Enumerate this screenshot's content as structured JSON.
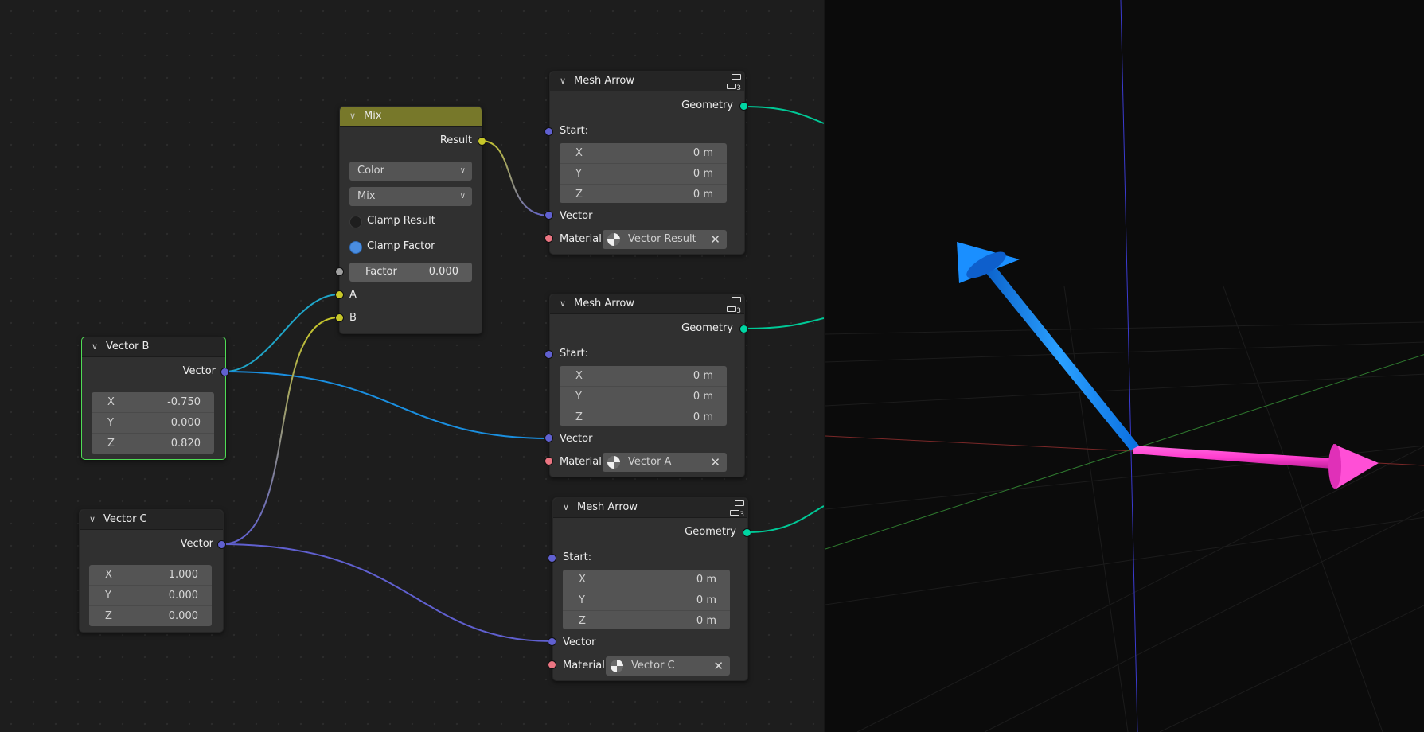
{
  "colors": {
    "vector_socket": "#6060d0",
    "geometry_socket": "#00d6a3",
    "material_socket": "#eb7582",
    "color_socket": "#c7c729",
    "arrow_blue": "#1a8fff",
    "arrow_pink": "#ff3fd0",
    "selected_outline": "#4fdc55"
  },
  "nodes": {
    "mix": {
      "title": "Mix",
      "output": "Result",
      "data_type": "Color",
      "blend_mode": "Mix",
      "clamp_result_label": "Clamp Result",
      "clamp_factor_label": "Clamp Factor",
      "factor_label": "Factor",
      "factor_value": "0.000",
      "input_a": "A",
      "input_b": "B"
    },
    "vector_b": {
      "title": "Vector B",
      "output": "Vector",
      "x_label": "X",
      "x": "-0.750",
      "y_label": "Y",
      "y": "0.000",
      "z_label": "Z",
      "z": "0.820"
    },
    "vector_c": {
      "title": "Vector C",
      "output": "Vector",
      "x_label": "X",
      "x": "1.000",
      "y_label": "Y",
      "y": "0.000",
      "z_label": "Z",
      "z": "0.000"
    },
    "arrow1": {
      "title": "Mesh Arrow",
      "badge": "3",
      "output": "Geometry",
      "start_label": "Start:",
      "x_label": "X",
      "x": "0 m",
      "y_label": "Y",
      "y": "0 m",
      "z_label": "Z",
      "z": "0 m",
      "vector_label": "Vector",
      "material_label": "Material:",
      "material": "Vector Result"
    },
    "arrow2": {
      "title": "Mesh Arrow",
      "badge": "3",
      "output": "Geometry",
      "start_label": "Start:",
      "x_label": "X",
      "x": "0 m",
      "y_label": "Y",
      "y": "0 m",
      "z_label": "Z",
      "z": "0 m",
      "vector_label": "Vector",
      "material_label": "Material:",
      "material": "Vector A"
    },
    "arrow3": {
      "title": "Mesh Arrow",
      "badge": "3",
      "output": "Geometry",
      "start_label": "Start:",
      "x_label": "X",
      "x": "0 m",
      "y_label": "Y",
      "y": "0 m",
      "z_label": "Z",
      "z": "0 m",
      "vector_label": "Vector",
      "material_label": "Material:",
      "material": "Vector C"
    }
  }
}
